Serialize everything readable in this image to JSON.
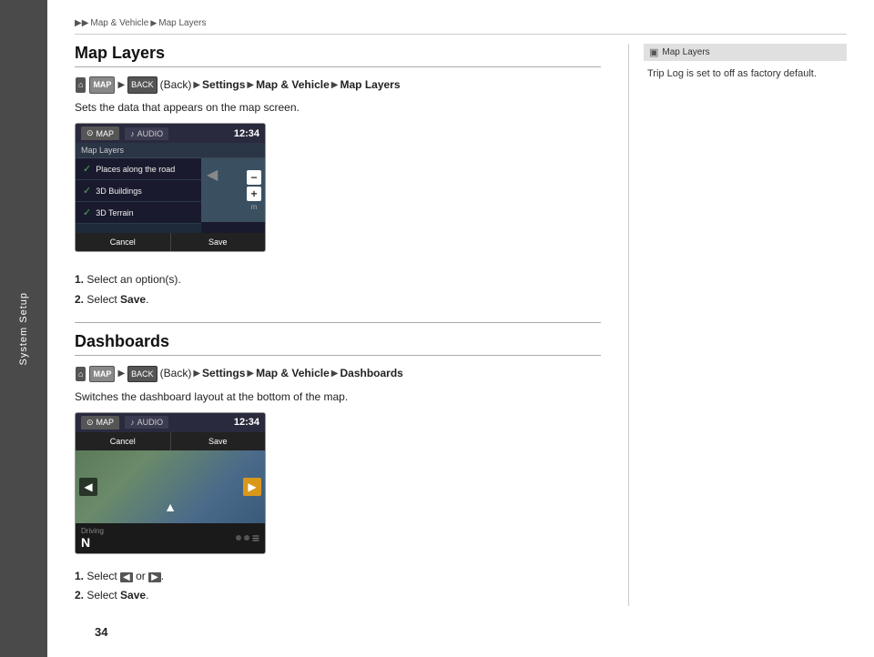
{
  "sidebar": {
    "label": "System Setup"
  },
  "breadcrumb": {
    "items": [
      "▶▶",
      "Map & Vehicle",
      "▶",
      "Map Layers"
    ]
  },
  "map_layers_section": {
    "title": "Map Layers",
    "nav_path": {
      "home_icon": "h",
      "map_icon": "MAP",
      "back_icon": "BACK",
      "back_label": "(Back)",
      "items": [
        "Settings",
        "Map & Vehicle",
        "Map Layers"
      ]
    },
    "description": "Sets the data that appears on the map screen.",
    "screen": {
      "tabs": [
        "MAP",
        "AUDIO"
      ],
      "title": "Map Layers",
      "time": "12:34",
      "layers": [
        {
          "label": "Places along the road",
          "checked": true
        },
        {
          "label": "3D Buildings",
          "checked": true
        },
        {
          "label": "3D Terrain",
          "checked": true
        }
      ],
      "buttons": [
        "Cancel",
        "Save"
      ]
    },
    "steps": [
      {
        "num": "1.",
        "text": "Select an option(s)."
      },
      {
        "num": "2.",
        "text": "Select ",
        "bold": "Save",
        "end": "."
      }
    ]
  },
  "dashboards_section": {
    "title": "Dashboards",
    "nav_path": {
      "home_icon": "h",
      "map_icon": "MAP",
      "back_icon": "BACK",
      "back_label": "(Back)",
      "items": [
        "Settings",
        "Map & Vehicle",
        "Dashboards"
      ]
    },
    "description": "Switches the dashboard layout at the bottom of the map.",
    "screen": {
      "tabs": [
        "MAP",
        "AUDIO"
      ],
      "time": "12:34",
      "buttons": [
        "Cancel",
        "Save"
      ],
      "direction_label": "Driving",
      "direction": "N"
    },
    "steps": [
      {
        "num": "1.",
        "text": "Select ",
        "icon1": "◀",
        "or": " or ",
        "icon2": "▶",
        "end": "."
      },
      {
        "num": "2.",
        "text": "Select ",
        "bold": "Save",
        "end": "."
      }
    ]
  },
  "info_box": {
    "title": "Map Layers",
    "icon": "▣",
    "text": "Trip Log is set to off as factory default."
  },
  "page_number": "34"
}
